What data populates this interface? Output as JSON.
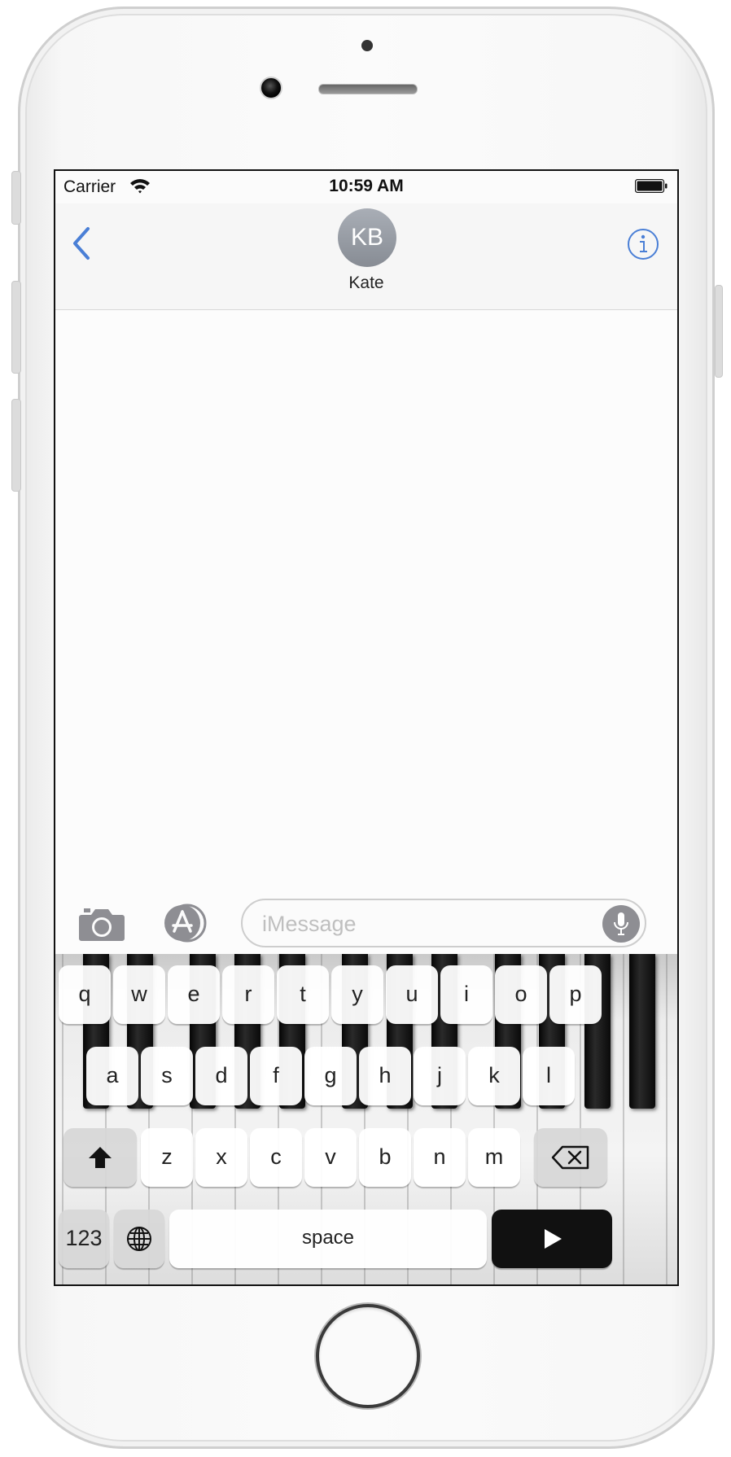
{
  "status_bar": {
    "carrier": "Carrier",
    "time": "10:59 AM"
  },
  "header": {
    "avatar_initials": "KB",
    "contact_name": "Kate"
  },
  "input": {
    "placeholder": "iMessage",
    "value": ""
  },
  "keyboard": {
    "row1": [
      "q",
      "w",
      "e",
      "r",
      "t",
      "y",
      "u",
      "i",
      "o",
      "p"
    ],
    "row2": [
      "a",
      "s",
      "d",
      "f",
      "g",
      "h",
      "j",
      "k",
      "l"
    ],
    "row3": [
      "z",
      "x",
      "c",
      "v",
      "b",
      "n",
      "m"
    ],
    "numbers_label": "123",
    "space_label": "space"
  },
  "colors": {
    "accent": "#4a7fd6",
    "avatar": "#989da5",
    "send_key": "#111111"
  },
  "icons": [
    "wifi-icon",
    "battery-icon",
    "back-chevron-icon",
    "info-icon",
    "camera-icon",
    "app-store-icon",
    "microphone-icon",
    "shift-icon",
    "delete-icon",
    "globe-icon",
    "send-arrow-icon"
  ]
}
